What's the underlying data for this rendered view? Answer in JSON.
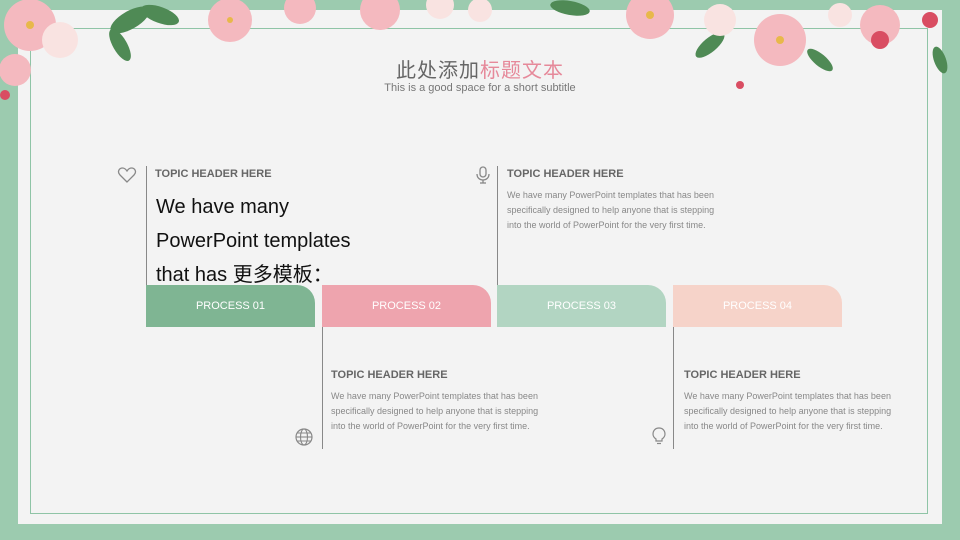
{
  "header": {
    "title_part1": "此处添加",
    "title_part2": "标题文本",
    "subtitle": "This is a good space for a short subtitle"
  },
  "topics": [
    {
      "header": "TOPIC HEADER HERE",
      "body": "We have many PowerPoint templates that has 更多模板：askpanda问盼答"
    },
    {
      "header": "TOPIC HEADER HERE",
      "body": "We have many PowerPoint templates that has been specifically designed to help anyone that is stepping into the world of PowerPoint for the very first time."
    },
    {
      "header": "TOPIC HEADER HERE",
      "body": "We have many PowerPoint templates that has been specifically designed to help anyone that is stepping into the world of PowerPoint for the very first time."
    },
    {
      "header": "TOPIC HEADER HERE",
      "body": "We have many PowerPoint templates that has been specifically designed to help anyone that is stepping into the world of PowerPoint for the very first time."
    }
  ],
  "processes": [
    {
      "label": "PROCESS 01",
      "color": "#7fb593"
    },
    {
      "label": "PROCESS 02",
      "color": "#eea4ae"
    },
    {
      "label": "PROCESS 03",
      "color": "#b2d5c2"
    },
    {
      "label": "PROCESS 04",
      "color": "#f6d3c9"
    }
  ],
  "icons": {
    "topic1": "heart-icon",
    "topic2": "microphone-icon",
    "topic3": "globe-icon",
    "topic4": "lightbulb-icon"
  },
  "colors": {
    "accent_pink": "#e6899a",
    "frame_green": "#9ccbaf"
  }
}
